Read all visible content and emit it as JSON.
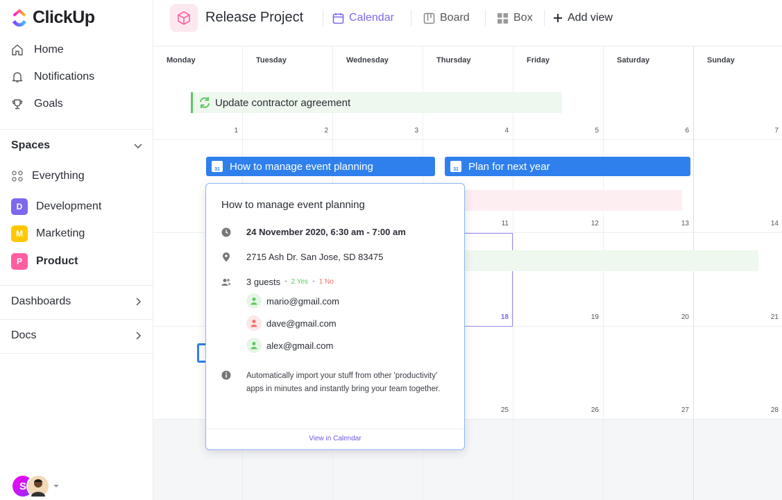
{
  "app": {
    "name": "ClickUp"
  },
  "sidebar": {
    "nav": [
      {
        "label": "Home",
        "icon": "home-icon"
      },
      {
        "label": "Notifications",
        "icon": "bell-icon"
      },
      {
        "label": "Goals",
        "icon": "trophy-icon"
      }
    ],
    "spaces_label": "Spaces",
    "everything_label": "Everything",
    "spaces": [
      {
        "badge": "D",
        "label": "Development",
        "color": "#7b68ee"
      },
      {
        "badge": "M",
        "label": "Marketing",
        "color": "#ffc800"
      },
      {
        "badge": "P",
        "label": "Product",
        "color": "#ff5ea0"
      }
    ],
    "dashboards_label": "Dashboards",
    "docs_label": "Docs",
    "user_initial": "S"
  },
  "header": {
    "project_title": "Release Project",
    "views": [
      {
        "label": "Calendar",
        "active": true
      },
      {
        "label": "Board",
        "active": false
      },
      {
        "label": "Box",
        "active": false
      }
    ],
    "add_view_label": "Add view"
  },
  "calendar": {
    "days": [
      "Monday",
      "Tuesday",
      "Wednesday",
      "Thursday",
      "Friday",
      "Saturday",
      "Sunday"
    ],
    "weeks": [
      [
        "1",
        "2",
        "3",
        "4",
        "5",
        "6",
        "7"
      ],
      [
        "",
        "",
        "",
        "11",
        "12",
        "13",
        "14"
      ],
      [
        "",
        "",
        "",
        "18",
        "19",
        "20",
        "21"
      ],
      [
        "",
        "",
        "",
        "25",
        "26",
        "27",
        "28"
      ]
    ],
    "events": {
      "contractor": "Update contractor agreement",
      "event_planning": "How to manage event planning",
      "next_year": "Plan for next year",
      "cal_icon_num": "31"
    }
  },
  "popup": {
    "title": "How to manage event planning",
    "datetime": "24 November 2020, 6:30 am - 7:00 am",
    "address": "2715 Ash Dr. San Jose, SD 83475",
    "guests_label": "3 guests",
    "yes_label": "2 Yes",
    "no_label": "1 No",
    "guests": [
      {
        "email": "mario@gmail.com",
        "status": "yes"
      },
      {
        "email": "dave@gmail.com",
        "status": "no"
      },
      {
        "email": "alex@gmail.com",
        "status": "yes"
      }
    ],
    "description": "Automatically import your stuff from other 'productivity' apps in minutes and instantly bring your team together.",
    "footer_link": "View in Calendar"
  },
  "colors": {
    "accent": "#7b68ee",
    "event_blue": "#2f80ed",
    "green": "#5cc95f",
    "red": "#f56c6c"
  }
}
